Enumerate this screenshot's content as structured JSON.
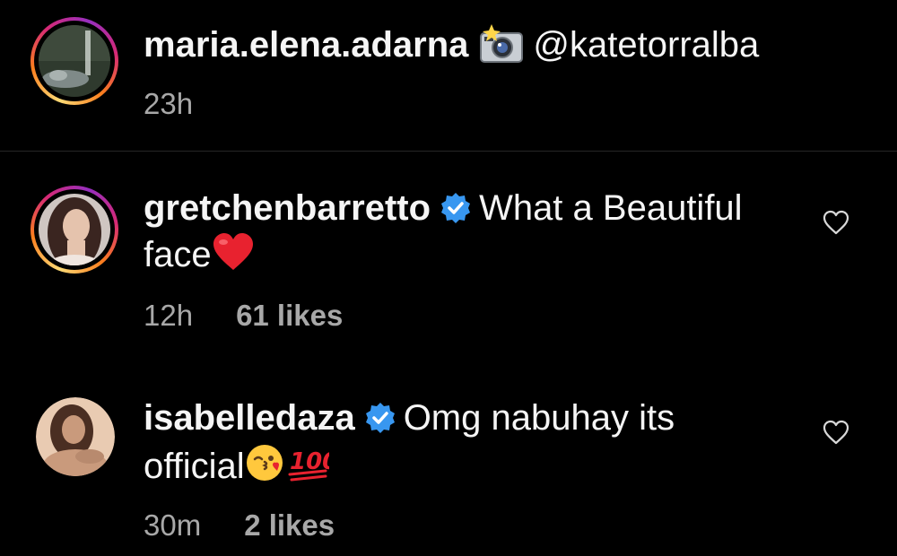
{
  "caption": {
    "username": "maria.elena.adarna",
    "mention": "@katetorralba",
    "time": "23h",
    "emoji": "camera-with-flash"
  },
  "comments": [
    {
      "username": "gretchenbarretto",
      "verified": true,
      "text_line1": "What a Beautiful",
      "text_line2": "face",
      "emoji": [
        "red-heart"
      ],
      "time": "12h",
      "likes": "61 likes"
    },
    {
      "username": "isabelledaza",
      "verified": true,
      "text_line1": "Omg nabuhay its",
      "text_line2": "official",
      "emoji": [
        "face-blowing-kiss",
        "hundred-points"
      ],
      "time": "30m",
      "likes": "2 likes"
    }
  ],
  "colors": {
    "background": "#000000",
    "text": "#f5f5f5",
    "meta": "#a8a8a8",
    "verified": "#3897f0",
    "heart_emoji": "#e8222f",
    "divider": "#262626"
  }
}
